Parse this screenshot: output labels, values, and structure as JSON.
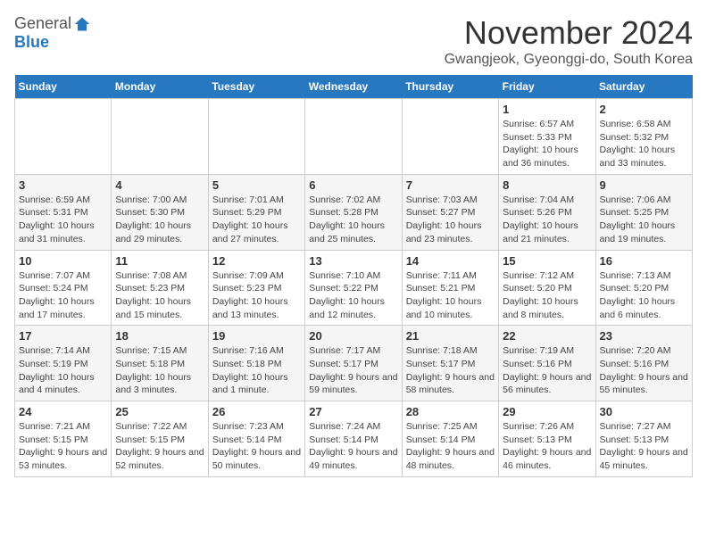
{
  "logo": {
    "general": "General",
    "blue": "Blue"
  },
  "title": "November 2024",
  "location": "Gwangjeok, Gyeonggi-do, South Korea",
  "weekdays": [
    "Sunday",
    "Monday",
    "Tuesday",
    "Wednesday",
    "Thursday",
    "Friday",
    "Saturday"
  ],
  "weeks": [
    [
      {
        "day": "",
        "info": ""
      },
      {
        "day": "",
        "info": ""
      },
      {
        "day": "",
        "info": ""
      },
      {
        "day": "",
        "info": ""
      },
      {
        "day": "",
        "info": ""
      },
      {
        "day": "1",
        "info": "Sunrise: 6:57 AM\nSunset: 5:33 PM\nDaylight: 10 hours and 36 minutes."
      },
      {
        "day": "2",
        "info": "Sunrise: 6:58 AM\nSunset: 5:32 PM\nDaylight: 10 hours and 33 minutes."
      }
    ],
    [
      {
        "day": "3",
        "info": "Sunrise: 6:59 AM\nSunset: 5:31 PM\nDaylight: 10 hours and 31 minutes."
      },
      {
        "day": "4",
        "info": "Sunrise: 7:00 AM\nSunset: 5:30 PM\nDaylight: 10 hours and 29 minutes."
      },
      {
        "day": "5",
        "info": "Sunrise: 7:01 AM\nSunset: 5:29 PM\nDaylight: 10 hours and 27 minutes."
      },
      {
        "day": "6",
        "info": "Sunrise: 7:02 AM\nSunset: 5:28 PM\nDaylight: 10 hours and 25 minutes."
      },
      {
        "day": "7",
        "info": "Sunrise: 7:03 AM\nSunset: 5:27 PM\nDaylight: 10 hours and 23 minutes."
      },
      {
        "day": "8",
        "info": "Sunrise: 7:04 AM\nSunset: 5:26 PM\nDaylight: 10 hours and 21 minutes."
      },
      {
        "day": "9",
        "info": "Sunrise: 7:06 AM\nSunset: 5:25 PM\nDaylight: 10 hours and 19 minutes."
      }
    ],
    [
      {
        "day": "10",
        "info": "Sunrise: 7:07 AM\nSunset: 5:24 PM\nDaylight: 10 hours and 17 minutes."
      },
      {
        "day": "11",
        "info": "Sunrise: 7:08 AM\nSunset: 5:23 PM\nDaylight: 10 hours and 15 minutes."
      },
      {
        "day": "12",
        "info": "Sunrise: 7:09 AM\nSunset: 5:23 PM\nDaylight: 10 hours and 13 minutes."
      },
      {
        "day": "13",
        "info": "Sunrise: 7:10 AM\nSunset: 5:22 PM\nDaylight: 10 hours and 12 minutes."
      },
      {
        "day": "14",
        "info": "Sunrise: 7:11 AM\nSunset: 5:21 PM\nDaylight: 10 hours and 10 minutes."
      },
      {
        "day": "15",
        "info": "Sunrise: 7:12 AM\nSunset: 5:20 PM\nDaylight: 10 hours and 8 minutes."
      },
      {
        "day": "16",
        "info": "Sunrise: 7:13 AM\nSunset: 5:20 PM\nDaylight: 10 hours and 6 minutes."
      }
    ],
    [
      {
        "day": "17",
        "info": "Sunrise: 7:14 AM\nSunset: 5:19 PM\nDaylight: 10 hours and 4 minutes."
      },
      {
        "day": "18",
        "info": "Sunrise: 7:15 AM\nSunset: 5:18 PM\nDaylight: 10 hours and 3 minutes."
      },
      {
        "day": "19",
        "info": "Sunrise: 7:16 AM\nSunset: 5:18 PM\nDaylight: 10 hours and 1 minute."
      },
      {
        "day": "20",
        "info": "Sunrise: 7:17 AM\nSunset: 5:17 PM\nDaylight: 9 hours and 59 minutes."
      },
      {
        "day": "21",
        "info": "Sunrise: 7:18 AM\nSunset: 5:17 PM\nDaylight: 9 hours and 58 minutes."
      },
      {
        "day": "22",
        "info": "Sunrise: 7:19 AM\nSunset: 5:16 PM\nDaylight: 9 hours and 56 minutes."
      },
      {
        "day": "23",
        "info": "Sunrise: 7:20 AM\nSunset: 5:16 PM\nDaylight: 9 hours and 55 minutes."
      }
    ],
    [
      {
        "day": "24",
        "info": "Sunrise: 7:21 AM\nSunset: 5:15 PM\nDaylight: 9 hours and 53 minutes."
      },
      {
        "day": "25",
        "info": "Sunrise: 7:22 AM\nSunset: 5:15 PM\nDaylight: 9 hours and 52 minutes."
      },
      {
        "day": "26",
        "info": "Sunrise: 7:23 AM\nSunset: 5:14 PM\nDaylight: 9 hours and 50 minutes."
      },
      {
        "day": "27",
        "info": "Sunrise: 7:24 AM\nSunset: 5:14 PM\nDaylight: 9 hours and 49 minutes."
      },
      {
        "day": "28",
        "info": "Sunrise: 7:25 AM\nSunset: 5:14 PM\nDaylight: 9 hours and 48 minutes."
      },
      {
        "day": "29",
        "info": "Sunrise: 7:26 AM\nSunset: 5:13 PM\nDaylight: 9 hours and 46 minutes."
      },
      {
        "day": "30",
        "info": "Sunrise: 7:27 AM\nSunset: 5:13 PM\nDaylight: 9 hours and 45 minutes."
      }
    ]
  ]
}
